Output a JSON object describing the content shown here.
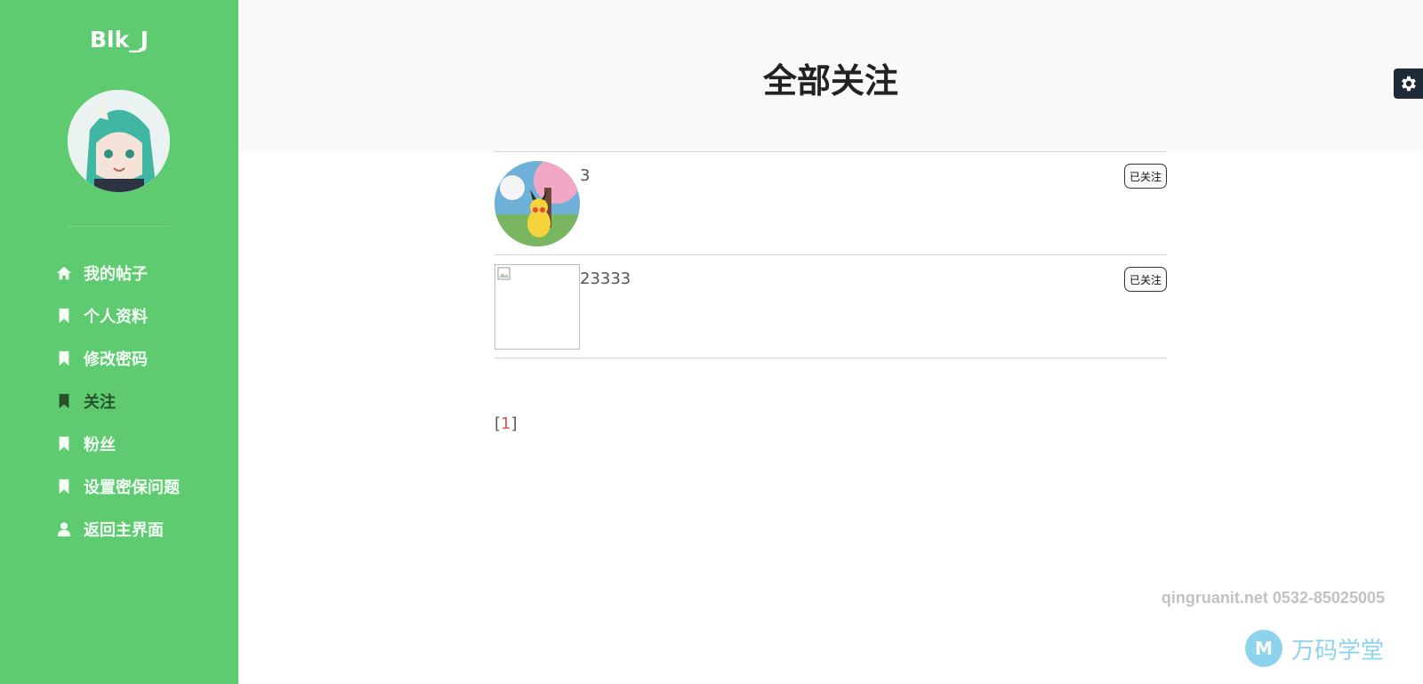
{
  "sidebar": {
    "brand": "Blk_J",
    "items": [
      {
        "label": "我的帖子",
        "icon": "home-icon"
      },
      {
        "label": "个人资料",
        "icon": "bookmark-icon"
      },
      {
        "label": "修改密码",
        "icon": "bookmark-icon"
      },
      {
        "label": "关注",
        "icon": "bookmark-icon",
        "active": true
      },
      {
        "label": "粉丝",
        "icon": "bookmark-icon"
      },
      {
        "label": "设置密保问题",
        "icon": "bookmark-icon"
      },
      {
        "label": "返回主界面",
        "icon": "user-icon"
      }
    ]
  },
  "header": {
    "title": "全部关注"
  },
  "follows": [
    {
      "name": "3",
      "button": "已关注",
      "avatar": "pikachu-avatar"
    },
    {
      "name": "23333",
      "button": "已关注",
      "avatar": "broken-image"
    }
  ],
  "pager": {
    "open": "[",
    "page": "1",
    "close": "]"
  },
  "watermark": {
    "text": "qingruanit.net 0532-85025005",
    "logo_text": "万码学堂",
    "logo_mark": "M"
  },
  "colors": {
    "sidebar": "#5fcb70",
    "header_bg": "#f9f9f9",
    "active_item": "#27502e",
    "gear_bg": "#1f2a37"
  }
}
